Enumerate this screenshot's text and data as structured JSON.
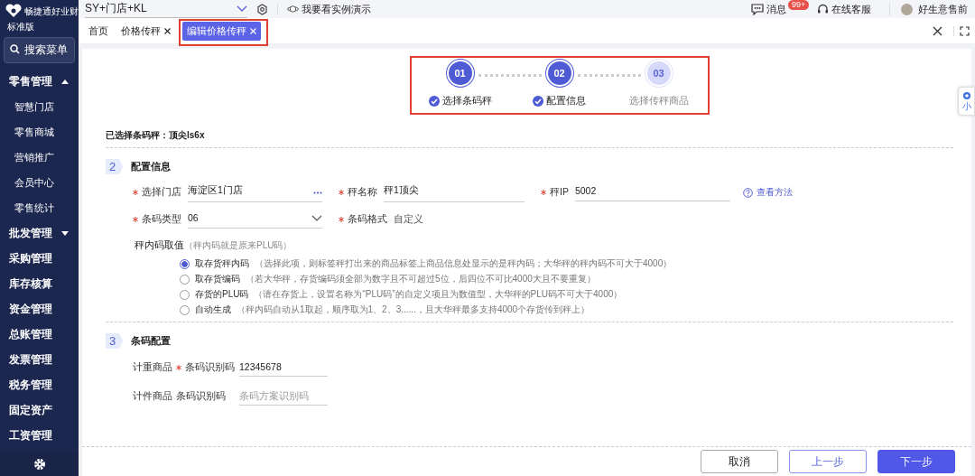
{
  "sidebar": {
    "brand": "畅捷通好业财",
    "edition": "标准版",
    "search": "搜索菜单",
    "items": [
      {
        "label": "零售管理",
        "expanded": true,
        "children": [
          {
            "label": "智慧门店"
          },
          {
            "label": "零售商城"
          },
          {
            "label": "营销推广"
          },
          {
            "label": "会员中心"
          },
          {
            "label": "零售统计"
          }
        ]
      },
      {
        "label": "批发管理",
        "expanded": false
      },
      {
        "label": "采购管理"
      },
      {
        "label": "库存核算"
      },
      {
        "label": "资金管理"
      },
      {
        "label": "总账管理"
      },
      {
        "label": "发票管理"
      },
      {
        "label": "税务管理"
      },
      {
        "label": "固定资产"
      },
      {
        "label": "工资管理"
      }
    ]
  },
  "top_bar": {
    "account": "SY+门店+KL",
    "demo": "我要看实例演示",
    "messages": {
      "label": "消息",
      "badge": "99+"
    },
    "service": "在线客服",
    "user": "好生意售前"
  },
  "tabs": [
    {
      "label": "首页",
      "closable": false,
      "selected": false
    },
    {
      "label": "价格传秤",
      "closable": true,
      "selected": false
    },
    {
      "label": "编辑价格传秤",
      "closable": true,
      "selected": true
    }
  ],
  "assistant": {
    "label": "小"
  },
  "steps": [
    {
      "number": "01",
      "label": "选择条码秤",
      "done": true
    },
    {
      "number": "02",
      "label": "配置信息",
      "done": true
    },
    {
      "number": "03",
      "label": "选择传秤商品",
      "done": false
    }
  ],
  "selected_scale": "已选择条码秤：顶尖ls6x",
  "config": {
    "number": "2",
    "title": "配置信息",
    "rows": [
      [
        {
          "label": "选择门店",
          "required": true,
          "kind": "lookup",
          "value": "海淀区1门店"
        },
        {
          "label": "秤名称",
          "required": true,
          "kind": "input",
          "value": "秤1顶尖"
        },
        {
          "label": "秤IP",
          "required": true,
          "kind": "input",
          "value": "5002"
        }
      ],
      [
        {
          "label": "条码类型",
          "required": true,
          "kind": "select",
          "value": "06"
        },
        {
          "label": "条码格式",
          "required": true,
          "kind": "static",
          "value": "自定义"
        }
      ]
    ],
    "help_link": "查看方法",
    "code_source": {
      "title": "秤内码取值",
      "hint": "（秤内码就是原来PLU码）",
      "options": [
        {
          "label": "取存货秤内码",
          "hint": "（选择此项，则标签秤打出来的商品标签上商品信息处显示的是秤内码；大华秤的秤内码不可大于4000）",
          "selected": true
        },
        {
          "label": "取存货编码",
          "hint": "（若大华秤，存货编码须全部为数字且不可超过5位，后四位不可比4000大且不要重复）",
          "selected": false
        },
        {
          "label": "存货的PLU码",
          "hint": "（请在存货上，设置名称为“PLU码”的自定义项且为数值型，大华秤的PLU码不可大于4000）",
          "selected": false
        },
        {
          "label": "自动生成",
          "hint": "（秤内码自动从1取起，顺序取为1、2、3......，且大华秤最多支持4000个存货传到秤上）",
          "selected": false
        }
      ]
    }
  },
  "barcode": {
    "number": "3",
    "title": "条码配置",
    "rows": [
      {
        "group": "计重商品",
        "label": "条码识别码",
        "required": true,
        "value": "12345678"
      },
      {
        "group": "计件商品",
        "label": "条码识别码",
        "required": false,
        "placeholder": "条码方案识别码"
      }
    ]
  },
  "buttons": [
    {
      "label": "取消",
      "kind": "plain"
    },
    {
      "label": "上一步",
      "kind": "outline"
    },
    {
      "label": "下一步",
      "kind": "primary"
    }
  ]
}
